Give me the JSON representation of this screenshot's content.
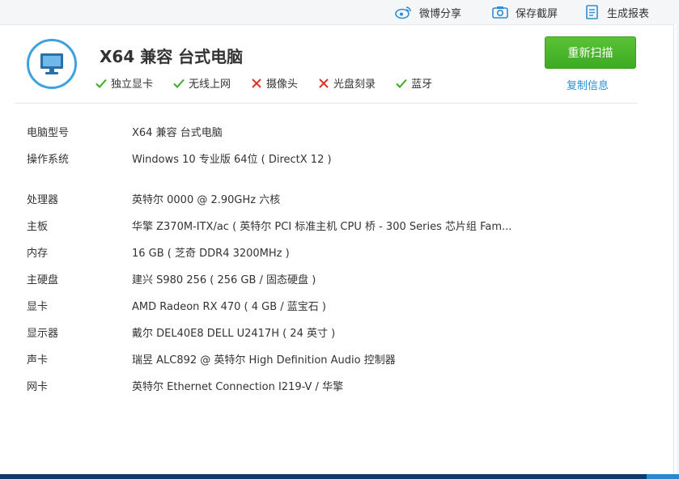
{
  "toolbar": {
    "weibo_label": "微博分享",
    "screenshot_label": "保存截屏",
    "report_label": "生成报表"
  },
  "header": {
    "title": "X64 兼容 台式电脑",
    "features": [
      {
        "label": "独立显卡",
        "status": "ok"
      },
      {
        "label": "无线上网",
        "status": "ok"
      },
      {
        "label": "摄像头",
        "status": "missing"
      },
      {
        "label": "光盘刻录",
        "status": "missing"
      },
      {
        "label": "蓝牙",
        "status": "ok"
      }
    ],
    "rescan_label": "重新扫描",
    "copy_label": "复制信息"
  },
  "info": [
    {
      "label": "电脑型号",
      "value": "X64 兼容 台式电脑"
    },
    {
      "label": "操作系统",
      "value": "Windows 10 专业版 64位 ( DirectX 12 )"
    },
    {
      "label": "处理器",
      "value": "英特尔 0000 @ 2.90GHz 六核"
    },
    {
      "label": "主板",
      "value": "华擎 Z370M-ITX/ac ( 英特尔 PCI 标准主机 CPU 桥 - 300 Series 芯片组 Fam..."
    },
    {
      "label": "内存",
      "value": "16 GB ( 芝奇 DDR4 3200MHz )"
    },
    {
      "label": "主硬盘",
      "value": "建兴 S980 256 ( 256 GB / 固态硬盘 )"
    },
    {
      "label": "显卡",
      "value": "AMD Radeon RX 470 ( 4 GB / 蓝宝石 )"
    },
    {
      "label": "显示器",
      "value": "戴尔 DEL40E8 DELL U2417H ( 24 英寸 )"
    },
    {
      "label": "声卡",
      "value": "瑞昱 ALC892 @ 英特尔 High Definition Audio 控制器"
    },
    {
      "label": "网卡",
      "value": "英特尔 Ethernet Connection  I219-V / 华擎"
    }
  ],
  "colors": {
    "accent_blue": "#3da2e0",
    "ok_green": "#3eaa22",
    "missing_red": "#e0312b",
    "link_blue": "#2a8fd6"
  }
}
